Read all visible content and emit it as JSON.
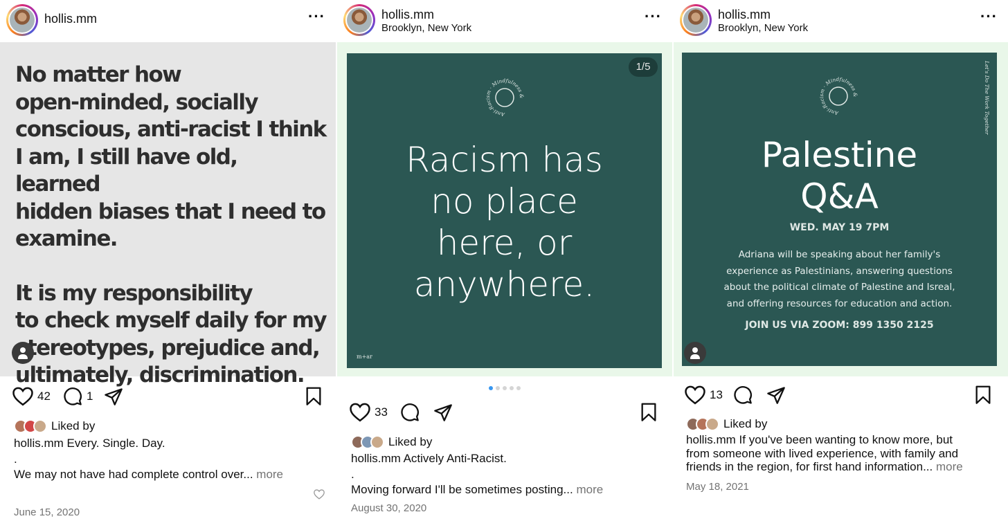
{
  "colors": {
    "post_green": "#2b5753",
    "frame_green": "#e9f7e9",
    "quote_bg": "#e6e6e6",
    "dot_active": "#3897f0",
    "muted": "#737373"
  },
  "posts": [
    {
      "username": "hollis.mm",
      "location": "",
      "image": {
        "kind": "text-quote",
        "paragraphs": [
          "No matter how\nopen-minded, socially\nconscious, anti-racist I think\nI am, I still have old, learned\nhidden biases that I need to\nexamine.",
          "It is my responsibility\nto check myself daily for my\nstereotypes, prejudice and,\nultimately, discrimination."
        ]
      },
      "likes": "42",
      "comments": "1",
      "liked_by_label": "Liked by",
      "caption_user": "hollis.mm",
      "caption_line1": "Every. Single. Day.",
      "caption_dot": ".",
      "caption_line2": "We may not have had complete control over...",
      "more_label": "more",
      "date": "June 15, 2020"
    },
    {
      "username": "hollis.mm",
      "location": "Brooklyn, New York",
      "image": {
        "kind": "green-slide",
        "counter": "1/5",
        "seal_text": "Anti-Racism · Mindfulness &",
        "headline": [
          "Racism has",
          "no place",
          "here, or",
          "anywhere."
        ],
        "brand": "m+ar",
        "dots_total": 5,
        "dots_active": 1
      },
      "likes": "33",
      "comments": "",
      "liked_by_label": "Liked by",
      "caption_user": "hollis.mm",
      "caption_line1": "Actively Anti-Racist.",
      "caption_dot": ".",
      "caption_line2": "Moving forward I'll be sometimes posting...",
      "more_label": "more",
      "date": "August 30, 2020"
    },
    {
      "username": "hollis.mm",
      "location": "Brooklyn, New York",
      "image": {
        "kind": "green-event",
        "side_text": "Let's Do The Work Together",
        "seal_text": "Anti-Racism · Mindfulness &",
        "headline": [
          "Palestine",
          "Q&A"
        ],
        "date_line": "WED. MAY 19 7PM",
        "body": [
          "Adriana will be speaking about her family's",
          "experience as Palestinians, answering questions",
          "about the political climate of Palestine and Isreal,",
          "and offering resources for education and action."
        ],
        "join": "JOIN US VIA ZOOM: 899 1350 2125"
      },
      "likes": "13",
      "comments": "",
      "liked_by_label": "Liked by",
      "caption_user": "hollis.mm",
      "caption_lines": [
        "If you've been wanting to know more, but",
        "from someone with lived experience, with family and",
        "friends in the region, for first hand information..."
      ],
      "more_label": "more",
      "date": "May 18, 2021"
    }
  ]
}
